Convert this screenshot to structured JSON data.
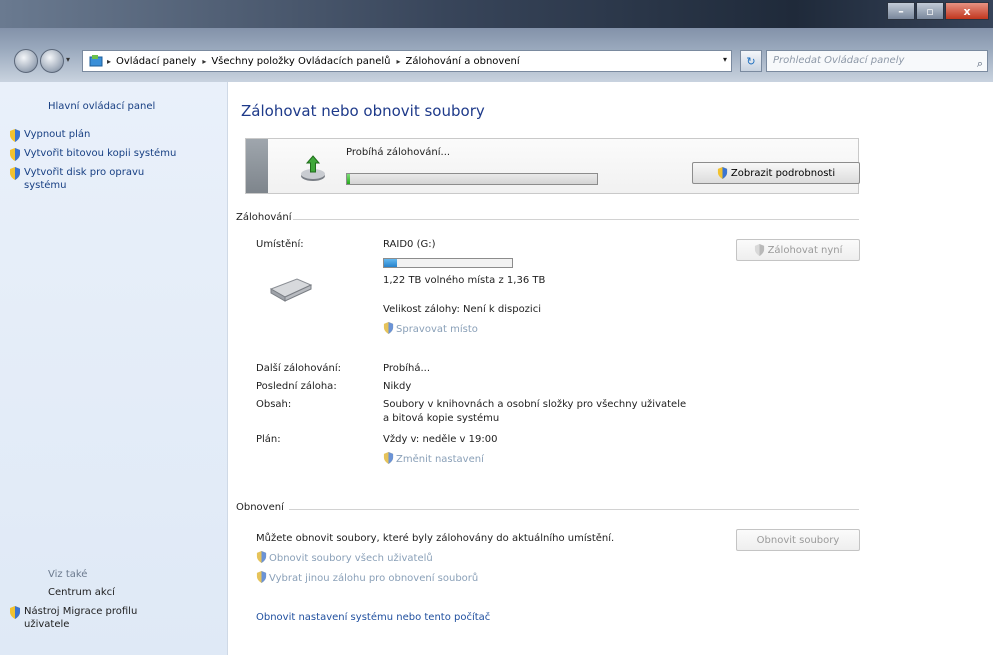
{
  "window": {
    "controls": [
      "minimize",
      "maximize",
      "close"
    ],
    "close_glyph": "x"
  },
  "address": {
    "breadcrumbs": [
      "Ovládací panely",
      "Všechny položky Ovládacích panelů",
      "Zálohování a obnovení"
    ],
    "search_placeholder": "Prohledat Ovládací panely"
  },
  "sidebar": {
    "home_label": "Hlavní ovládací panel",
    "items": [
      {
        "label": "Vypnout plán",
        "icon": "shield-icon"
      },
      {
        "label": "Vytvořit bitovou kopii systému",
        "icon": "shield-icon"
      },
      {
        "label": "Vytvořit disk pro opravu systému",
        "icon": "shield-icon"
      }
    ],
    "see_also_label": "Viz také",
    "see_also_items": [
      {
        "label": "Centrum akcí"
      },
      {
        "label": "Nástroj Migrace profilu uživatele",
        "icon": "shield-icon"
      }
    ]
  },
  "main": {
    "title": "Zálohovat nebo obnovit soubory",
    "progress": {
      "label": "Probíhá zálohování...",
      "fraction": 0.01,
      "details_button": "Zobrazit podrobnosti"
    },
    "backup": {
      "section_label": "Zálohování",
      "location_label": "Umístění:",
      "location_value": "RAID0 (G:)",
      "space_used_fraction": 0.1,
      "free_space_text": "1,22 TB volného místa z 1,36 TB",
      "backup_size_text": "Velikost zálohy: Není k dispozici",
      "manage_space_link": "Spravovat místo",
      "backup_now_button": "Zálohovat nyní",
      "next_backup_label": "Další zálohování:",
      "next_backup_value": "Probíhá...",
      "last_backup_label": "Poslední záloha:",
      "last_backup_value": "Nikdy",
      "contents_label": "Obsah:",
      "contents_value_line1": "Soubory v knihovnách a osobní složky pro všechny uživatele",
      "contents_value_line2": "a bitová kopie systému",
      "schedule_label": "Plán:",
      "schedule_value": "Vždy v: neděle v 19:00",
      "change_settings_link": "Změnit nastavení"
    },
    "restore": {
      "section_label": "Obnovení",
      "description": "Můžete obnovit soubory, které byly zálohovány do aktuálního umístění.",
      "restore_files_button": "Obnovit soubory",
      "restore_all_users_link": "Obnovit soubory všech uživatelů",
      "select_other_backup_link": "Vybrat jinou zálohu pro obnovení souborů",
      "recover_system_link": "Obnovit nastavení systému nebo tento počítač"
    }
  },
  "colors": {
    "link": "#173f83",
    "disabled_link": "#8aa0b8",
    "progress_green": "#26a81c",
    "space_blue": "#2682cc"
  }
}
